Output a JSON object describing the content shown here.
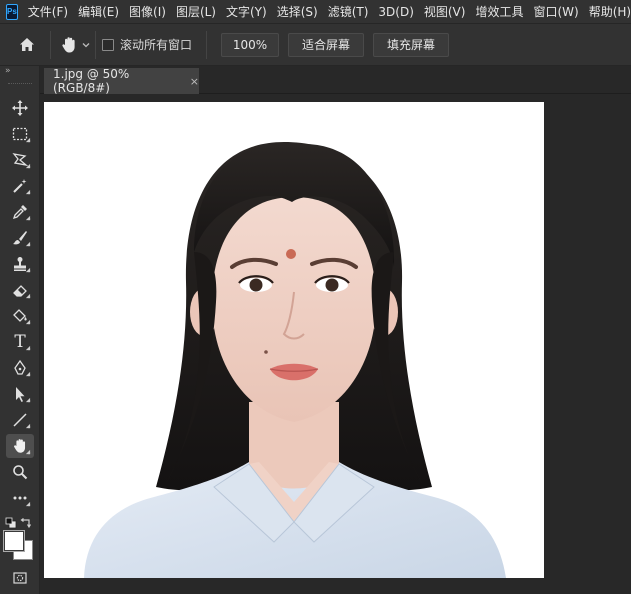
{
  "app": {
    "logo_text": "Ps",
    "menu": [
      "文件(F)",
      "编辑(E)",
      "图像(I)",
      "图层(L)",
      "文字(Y)",
      "选择(S)",
      "滤镜(T)",
      "3D(D)",
      "视图(V)",
      "增效工具",
      "窗口(W)",
      "帮助(H)"
    ]
  },
  "options": {
    "scroll_all_label": "滚动所有窗口",
    "zoom_percent": "100%",
    "fit_screen": "适合屏幕",
    "fill_screen": "填充屏幕"
  },
  "document": {
    "tab_title": "1.jpg @ 50%(RGB/8#)",
    "close_glyph": "×"
  },
  "toolbar": {
    "collapse_glyph": "»",
    "type_tool_glyph": "T",
    "active_tool": "hand-tool"
  },
  "colors": {
    "accent": "#31a8ff",
    "background": "#323232",
    "canvas": "#282828"
  }
}
